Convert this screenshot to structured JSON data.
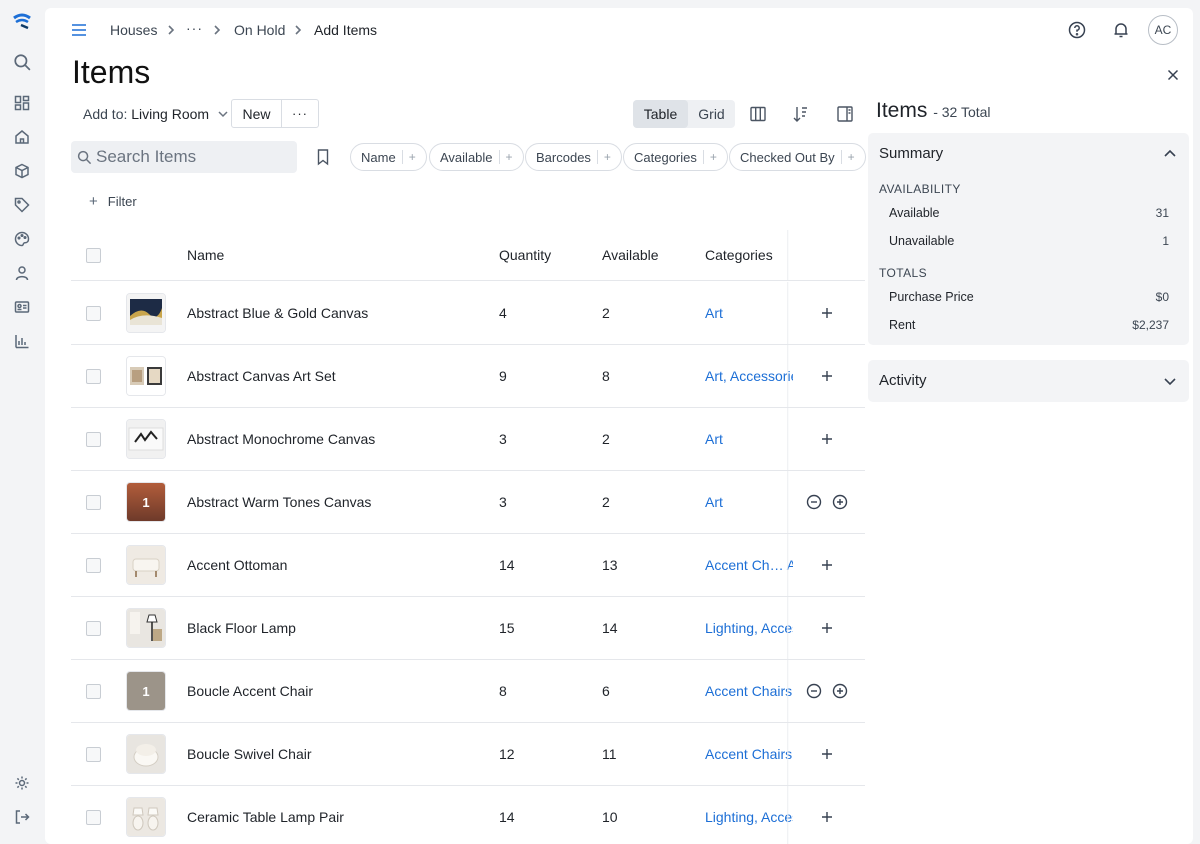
{
  "header": {
    "breadcrumbs": [
      "Houses",
      "On Hold",
      "Add Items"
    ],
    "avatar_initials": "AC"
  },
  "page": {
    "title": "Items",
    "add_to_label": "Add to:",
    "add_to_value": "Living Room",
    "new_button": "New",
    "view_table": "Table",
    "view_grid": "Grid",
    "search_placeholder": "Search Items",
    "filter_label": "Filter",
    "chips": [
      "Name",
      "Available",
      "Barcodes",
      "Categories",
      "Checked Out By"
    ]
  },
  "table": {
    "columns": [
      "Name",
      "Quantity",
      "Available",
      "Categories"
    ],
    "rows": [
      {
        "name": "Abstract Blue & Gold Canvas",
        "quantity": "4",
        "available": "2",
        "categories": "Art",
        "badge": ""
      },
      {
        "name": "Abstract Canvas Art Set",
        "quantity": "9",
        "available": "8",
        "categories": "Art, Accessories",
        "badge": ""
      },
      {
        "name": "Abstract Monochrome Canvas",
        "quantity": "3",
        "available": "2",
        "categories": "Art",
        "badge": ""
      },
      {
        "name": "Abstract Warm Tones Canvas",
        "quantity": "3",
        "available": "2",
        "categories": "Art",
        "badge": "1"
      },
      {
        "name": "Accent Ottoman",
        "quantity": "14",
        "available": "13",
        "categories": "Accent Ch… A",
        "badge": ""
      },
      {
        "name": "Black Floor Lamp",
        "quantity": "15",
        "available": "14",
        "categories": "Lighting, Acces",
        "badge": ""
      },
      {
        "name": "Boucle Accent Chair",
        "quantity": "8",
        "available": "6",
        "categories": "Accent Chairs,",
        "badge": "1"
      },
      {
        "name": "Boucle Swivel Chair",
        "quantity": "12",
        "available": "11",
        "categories": "Accent Chairs,",
        "badge": ""
      },
      {
        "name": "Ceramic Table Lamp Pair",
        "quantity": "14",
        "available": "10",
        "categories": "Lighting, Acces",
        "badge": ""
      }
    ]
  },
  "sidebar": {
    "title": "Items",
    "total": "- 32 Total",
    "summary_label": "Summary",
    "availability_label": "AVAILABILITY",
    "available_label": "Available",
    "available_value": "31",
    "unavailable_label": "Unavailable",
    "unavailable_value": "1",
    "totals_label": "TOTALS",
    "purchase_label": "Purchase Price",
    "purchase_value": "$0",
    "rent_label": "Rent",
    "rent_value": "$2,237",
    "activity_label": "Activity"
  },
  "colors": {
    "link": "#1d6fd6",
    "panel_bg": "#f3f4f6"
  }
}
